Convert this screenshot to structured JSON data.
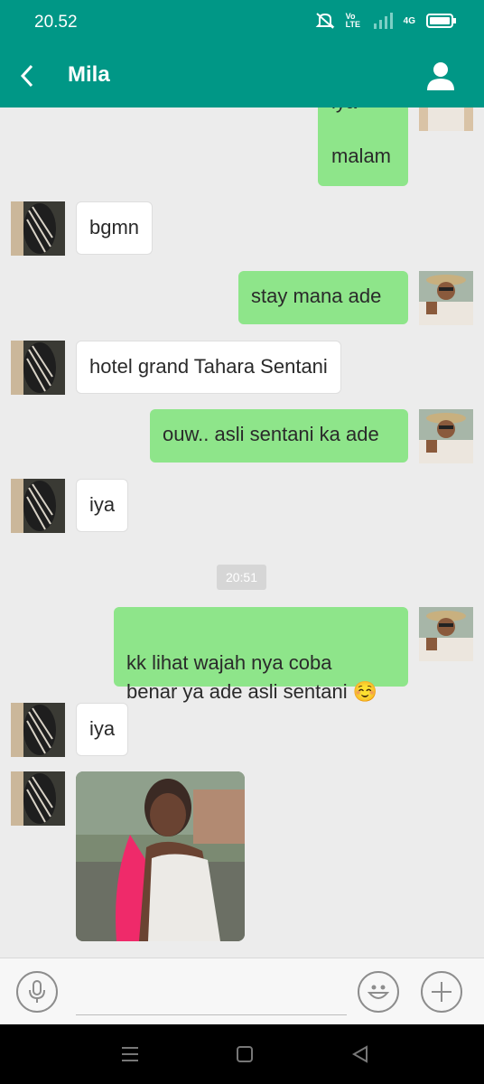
{
  "status_bar": {
    "time": "20.52",
    "network_label": "4G",
    "volte_label": "Vo LTE"
  },
  "header": {
    "back_icon": "chevron-left-icon",
    "title": "Mila",
    "profile_icon": "person-icon"
  },
  "messages": [
    {
      "direction": "out",
      "text": "iya\n\nmalam",
      "partial": true
    },
    {
      "direction": "in",
      "text": "bgmn"
    },
    {
      "direction": "out",
      "text": "stay mana ade"
    },
    {
      "direction": "in",
      "text": "hotel grand Tahara Sentani"
    },
    {
      "direction": "out",
      "text": "ouw.. asli sentani ka ade"
    },
    {
      "direction": "in",
      "text": "iya"
    },
    {
      "type": "timestamp",
      "text": "20:51"
    },
    {
      "direction": "out",
      "text": "kk lihat wajah nya coba\nbenar ya ade asli sentani ☺️"
    },
    {
      "direction": "in",
      "text": "iya"
    },
    {
      "direction": "in",
      "type": "image",
      "description_icon": "photo"
    }
  ],
  "input_bar": {
    "voice_icon": "microphone-icon",
    "emoji_icon": "smiley-icon",
    "add_icon": "plus-icon",
    "placeholder": ""
  },
  "nav_bar": {
    "menu_icon": "menu-icon",
    "home_icon": "home-icon",
    "back_icon": "triangle-back-icon"
  },
  "colors": {
    "header": "#009786",
    "outgoing_bubble": "#8ee58a",
    "incoming_bubble": "#ffffff",
    "background": "#ececec"
  }
}
